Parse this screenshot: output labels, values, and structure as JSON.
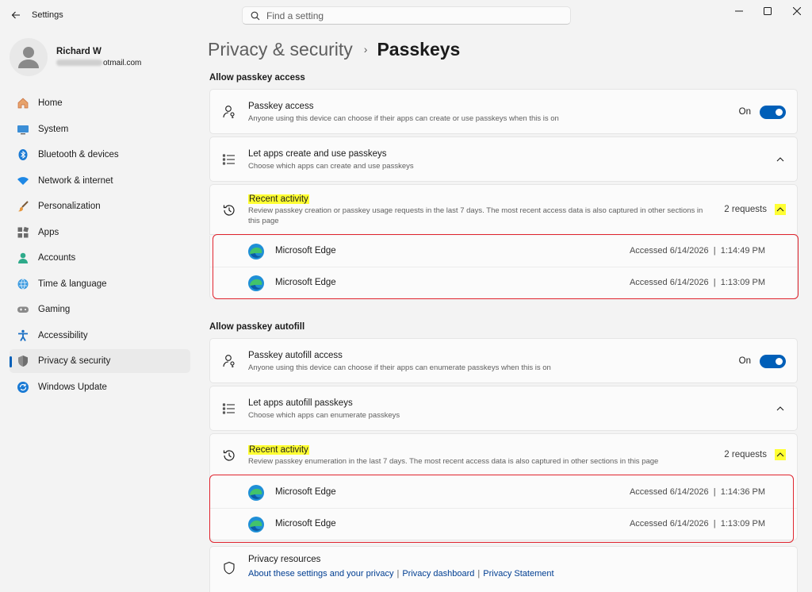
{
  "window": {
    "title": "Settings",
    "search_placeholder": "Find a setting"
  },
  "profile": {
    "name": "Richard W",
    "email_visible": "otmail.com"
  },
  "sidebar": {
    "items": [
      {
        "label": "Home",
        "icon": "home-icon"
      },
      {
        "label": "System",
        "icon": "system-icon"
      },
      {
        "label": "Bluetooth & devices",
        "icon": "bluetooth-icon"
      },
      {
        "label": "Network & internet",
        "icon": "wifi-icon"
      },
      {
        "label": "Personalization",
        "icon": "brush-icon"
      },
      {
        "label": "Apps",
        "icon": "apps-icon"
      },
      {
        "label": "Accounts",
        "icon": "accounts-icon"
      },
      {
        "label": "Time & language",
        "icon": "globe-icon"
      },
      {
        "label": "Gaming",
        "icon": "gamepad-icon"
      },
      {
        "label": "Accessibility",
        "icon": "accessibility-icon"
      },
      {
        "label": "Privacy & security",
        "icon": "shield-icon",
        "selected": true
      },
      {
        "label": "Windows Update",
        "icon": "update-icon"
      }
    ]
  },
  "breadcrumb": {
    "parent": "Privacy & security",
    "separator": "›",
    "current": "Passkeys"
  },
  "access_section": {
    "title": "Allow passkey access",
    "passkey_access": {
      "title": "Passkey access",
      "desc": "Anyone using this device can choose if their apps can create or use passkeys when this is on",
      "toggle_label": "On"
    },
    "let_apps": {
      "title": "Let apps create and use passkeys",
      "desc": "Choose which apps can create and use passkeys"
    },
    "recent": {
      "title": "Recent activity",
      "desc": "Review passkey creation or passkey usage requests in the last 7 days. The most recent access data is also captured in other sections in this page",
      "count": "2 requests"
    },
    "rows": [
      {
        "app": "Microsoft Edge",
        "accessed": "Accessed 6/14/2026  |  1:14:49 PM"
      },
      {
        "app": "Microsoft Edge",
        "accessed": "Accessed 6/14/2026  |  1:13:09 PM"
      }
    ]
  },
  "autofill_section": {
    "title": "Allow passkey autofill",
    "autofill_access": {
      "title": "Passkey autofill access",
      "desc": "Anyone using this device can choose if their apps can enumerate passkeys when this is on",
      "toggle_label": "On"
    },
    "let_apps": {
      "title": "Let apps autofill passkeys",
      "desc": "Choose which apps can enumerate passkeys"
    },
    "recent": {
      "title": "Recent activity",
      "desc": "Review passkey enumeration in the last 7 days. The most recent access data is also captured in other sections in this page",
      "count": "2 requests"
    },
    "rows": [
      {
        "app": "Microsoft Edge",
        "accessed": "Accessed 6/14/2026  |  1:14:36 PM"
      },
      {
        "app": "Microsoft Edge",
        "accessed": "Accessed 6/14/2026  |  1:13:09 PM"
      }
    ]
  },
  "privacy_resources": {
    "title": "Privacy resources",
    "links": [
      "About these settings and your privacy",
      "Privacy dashboard",
      "Privacy Statement"
    ],
    "separator": "|"
  },
  "colors": {
    "accent": "#005fb8",
    "highlight": "#ffff33",
    "annotation_red": "#e0242e"
  }
}
